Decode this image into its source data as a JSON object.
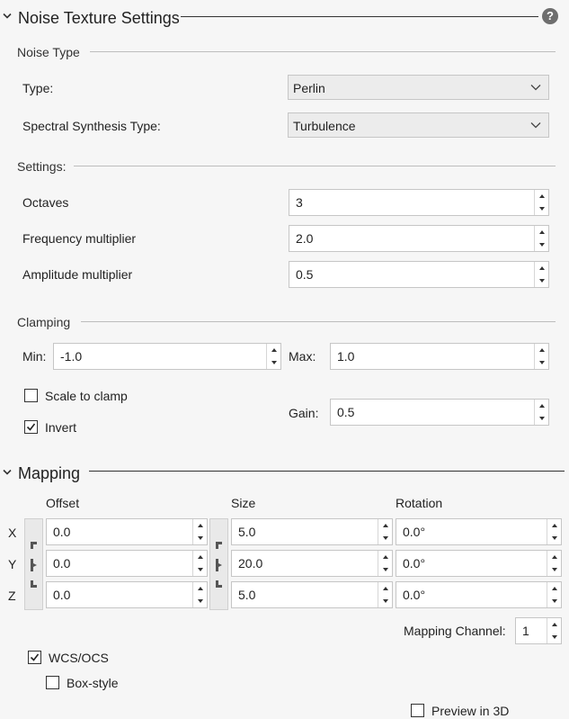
{
  "header": {
    "title": "Noise Texture Settings",
    "help_icon": "help-icon"
  },
  "noise_type": {
    "title": "Noise Type",
    "type_label": "Type:",
    "type_value": "Perlin",
    "spectral_label": "Spectral Synthesis Type:",
    "spectral_value": "Turbulence"
  },
  "settings": {
    "title": "Settings:",
    "octaves_label": "Octaves",
    "octaves_value": "3",
    "frequency_label": "Frequency multiplier",
    "frequency_value": "2.0",
    "amplitude_label": "Amplitude multiplier",
    "amplitude_value": "0.5"
  },
  "clamping": {
    "title": "Clamping",
    "min_label": "Min:",
    "min_value": "-1.0",
    "max_label": "Max:",
    "max_value": "1.0",
    "scale_to_clamp_label": "Scale to clamp",
    "scale_to_clamp_checked": false,
    "invert_label": "Invert",
    "invert_checked": true,
    "gain_label": "Gain:",
    "gain_value": "0.5"
  },
  "mapping": {
    "title": "Mapping",
    "offset_label": "Offset",
    "size_label": "Size",
    "rotation_label": "Rotation",
    "axes": [
      "X",
      "Y",
      "Z"
    ],
    "offset": [
      "0.0",
      "0.0",
      "0.0"
    ],
    "size": [
      "5.0",
      "20.0",
      "5.0"
    ],
    "rotation": [
      "0.0°",
      "0.0°",
      "0.0°"
    ],
    "channel_label": "Mapping Channel:",
    "channel_value": "1",
    "wcs_label": "WCS/OCS",
    "wcs_checked": true,
    "box_style_label": "Box-style",
    "box_style_checked": false,
    "preview_label": "Preview in 3D",
    "preview_checked": false
  }
}
